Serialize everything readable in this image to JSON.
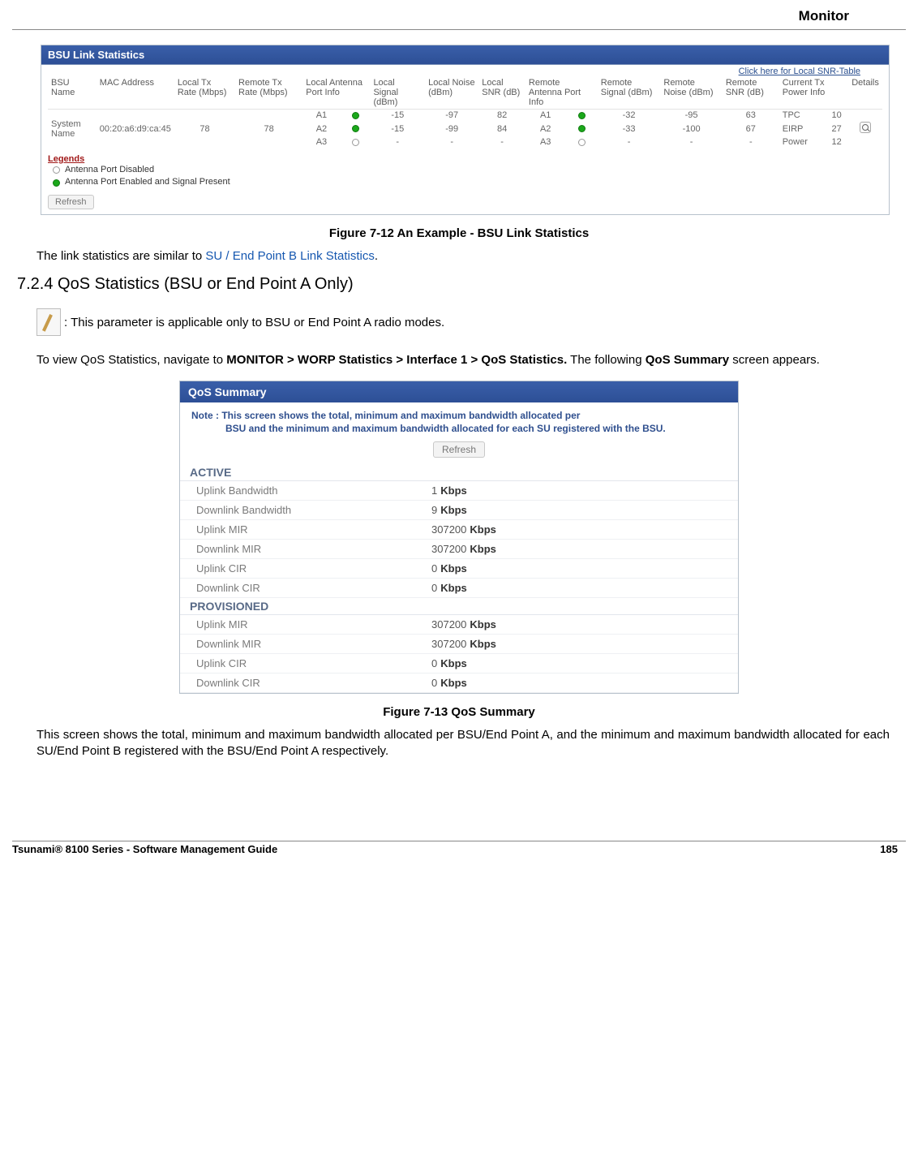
{
  "header": {
    "section": "Monitor"
  },
  "bsu_panel": {
    "title": "BSU Link Statistics",
    "snr_link": "Click here for Local SNR-Table",
    "columns": [
      "BSU Name",
      "MAC Address",
      "Local Tx Rate (Mbps)",
      "Remote Tx Rate (Mbps)",
      "Local Antenna Port Info",
      "Local Signal (dBm)",
      "Local Noise (dBm)",
      "Local SNR (dB)",
      "Remote Antenna Port Info",
      "Remote Signal (dBm)",
      "Remote Noise (dBm)",
      "Remote SNR (dB)",
      "Current Tx Power Info",
      "Details"
    ],
    "row": {
      "bsu_name": "System Name",
      "mac": "00:20:a6:d9:ca:45",
      "local_tx": "78",
      "remote_tx": "78",
      "antennas": [
        {
          "local_port": "A1",
          "local_state": "green",
          "l_sig": "-15",
          "l_noise": "-97",
          "l_snr": "82",
          "remote_port": "A1",
          "remote_state": "green",
          "r_sig": "-32",
          "r_noise": "-95",
          "r_snr": "63",
          "tp_label": "TPC",
          "tp_val": "10"
        },
        {
          "local_port": "A2",
          "local_state": "green",
          "l_sig": "-15",
          "l_noise": "-99",
          "l_snr": "84",
          "remote_port": "A2",
          "remote_state": "green",
          "r_sig": "-33",
          "r_noise": "-100",
          "r_snr": "67",
          "tp_label": "EIRP",
          "tp_val": "27"
        },
        {
          "local_port": "A3",
          "local_state": "white",
          "l_sig": "-",
          "l_noise": "-",
          "l_snr": "-",
          "remote_port": "A3",
          "remote_state": "white",
          "r_sig": "-",
          "r_noise": "-",
          "r_snr": "-",
          "tp_label": "Power",
          "tp_val": "12"
        }
      ]
    },
    "legends_title": "Legends",
    "legend_disabled": "Antenna Port Disabled",
    "legend_enabled": "Antenna Port Enabled and Signal Present",
    "refresh": "Refresh"
  },
  "fig12_caption": "Figure 7-12 An Example - BSU Link Statistics",
  "para_link_intro": "The link statistics are similar to ",
  "para_link_text": "SU / End Point B Link Statistics",
  "para_link_suffix": ".",
  "section_heading": "7.2.4 QoS Statistics (BSU or End Point A Only)",
  "note_text": ": This parameter is applicable only to BSU or End Point A radio modes.",
  "nav_para_1": "To view QoS Statistics, navigate to ",
  "nav_bold": "MONITOR > WORP Statistics > Interface 1 > QoS Statistics.",
  "nav_para_2": " The following ",
  "nav_bold2": "QoS Summary",
  "nav_para_3": " screen appears.",
  "qos": {
    "title": "QoS Summary",
    "note_line1": "Note : This screen shows the total, minimum and maximum bandwidth allocated per",
    "note_line2": "BSU and the minimum and maximum bandwidth allocated for each SU registered with the BSU.",
    "refresh": "Refresh",
    "active_title": "ACTIVE",
    "provisioned_title": "PROVISIONED",
    "active": [
      {
        "label": "Uplink Bandwidth",
        "val": "1",
        "unit": "Kbps"
      },
      {
        "label": "Downlink Bandwidth",
        "val": "9",
        "unit": "Kbps"
      },
      {
        "label": "Uplink MIR",
        "val": "307200",
        "unit": "Kbps"
      },
      {
        "label": "Downlink MIR",
        "val": "307200",
        "unit": "Kbps"
      },
      {
        "label": "Uplink CIR",
        "val": "0",
        "unit": "Kbps"
      },
      {
        "label": "Downlink CIR",
        "val": "0",
        "unit": "Kbps"
      }
    ],
    "provisioned": [
      {
        "label": "Uplink MIR",
        "val": "307200",
        "unit": "Kbps"
      },
      {
        "label": "Downlink MIR",
        "val": "307200",
        "unit": "Kbps"
      },
      {
        "label": "Uplink CIR",
        "val": "0",
        "unit": "Kbps"
      },
      {
        "label": "Downlink CIR",
        "val": "0",
        "unit": "Kbps"
      }
    ]
  },
  "fig13_caption": "Figure 7-13 QoS Summary",
  "closing_para": "This screen shows the total, minimum and maximum bandwidth allocated per BSU/End Point A, and the minimum and maximum bandwidth allocated for each SU/End Point B registered with the BSU/End Point A respectively.",
  "footer": {
    "left": "Tsunami® 8100 Series - Software Management Guide",
    "right": "185"
  }
}
